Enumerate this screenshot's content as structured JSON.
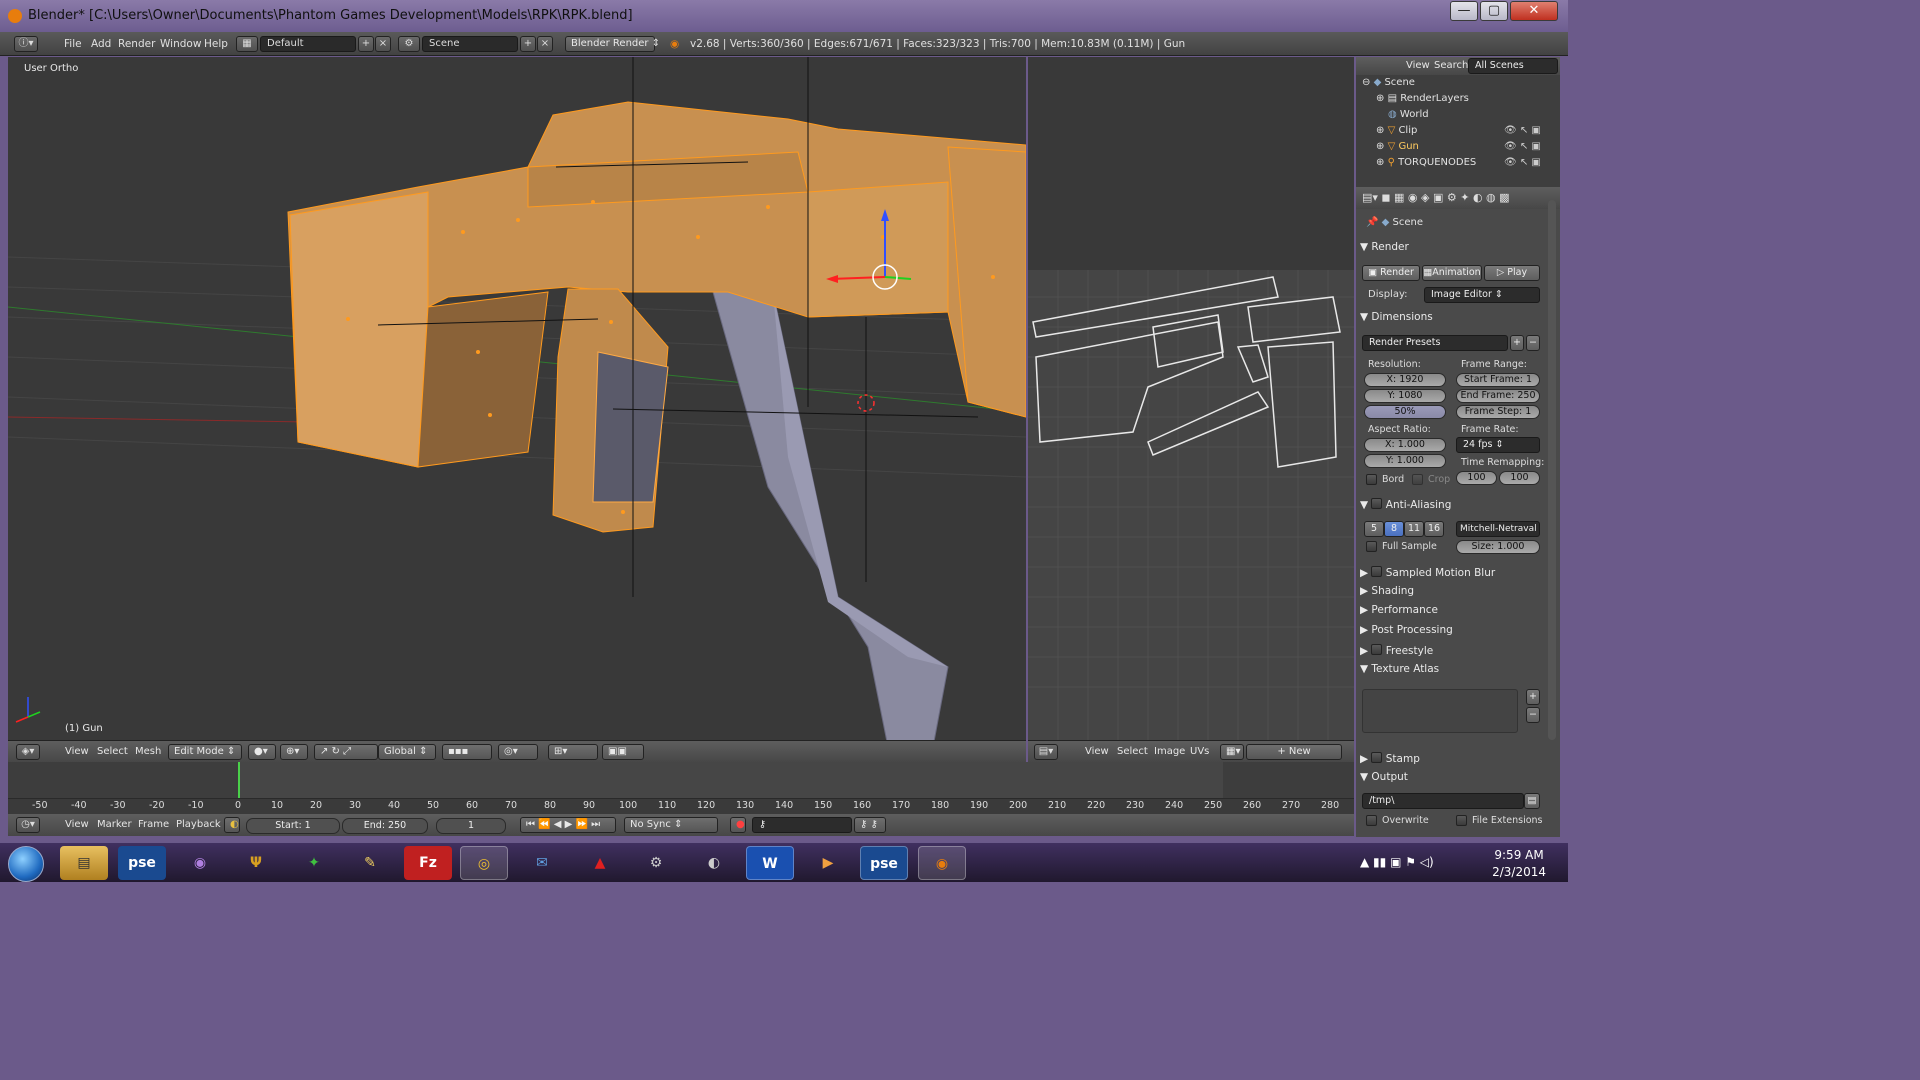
{
  "window": {
    "title": "Blender* [C:\\Users\\Owner\\Documents\\Phantom Games Development\\Models\\RPK\\RPK.blend]",
    "buttons": [
      "—",
      "▢",
      "✕"
    ]
  },
  "info_header": {
    "menus": [
      "File",
      "Add",
      "Render",
      "Window",
      "Help"
    ],
    "screen_layout": "Default",
    "scene": "Scene",
    "engine": "Blender Render",
    "stats": "v2.68 | Verts:360/360 | Edges:671/671 | Faces:323/323 | Tris:700 | Mem:10.83M (0.11M) | Gun"
  },
  "viewport": {
    "view_label": "User Ortho",
    "object_label": "(1) Gun"
  },
  "view3d_header": {
    "menus": [
      "View",
      "Select",
      "Mesh"
    ],
    "mode": "Edit Mode",
    "orientation": "Global"
  },
  "uv_header": {
    "menus": [
      "View",
      "Select",
      "Image",
      "UVs"
    ],
    "new_label": "New"
  },
  "timeline": {
    "ticks": [
      "-50",
      "-40",
      "-30",
      "-20",
      "-10",
      "0",
      "10",
      "20",
      "30",
      "40",
      "50",
      "60",
      "70",
      "80",
      "90",
      "100",
      "110",
      "120",
      "130",
      "140",
      "150",
      "160",
      "170",
      "180",
      "190",
      "200",
      "210",
      "220",
      "230",
      "240",
      "250",
      "260",
      "270",
      "280"
    ],
    "menus": [
      "View",
      "Marker",
      "Frame",
      "Playback"
    ],
    "start": "Start: 1",
    "end": "End: 250",
    "current": "1",
    "sync": "No Sync"
  },
  "outliner": {
    "menus": [
      "View",
      "Search"
    ],
    "filter": "All Scenes",
    "items": [
      "Scene",
      "RenderLayers",
      "World",
      "Clip",
      "Gun",
      "TORQUENODES"
    ]
  },
  "properties": {
    "context": "Scene",
    "render_panel": "Render",
    "render_btn": "Render",
    "animation_btn": "Animation",
    "play_btn": "Play",
    "display_label": "Display:",
    "display_value": "Image Editor",
    "dimensions_panel": "Dimensions",
    "presets": "Render Presets",
    "resolution_label": "Resolution:",
    "res_x": "X: 1920",
    "res_y": "Y: 1080",
    "res_pct": "50%",
    "frame_range_label": "Frame Range:",
    "start_frame": "Start Frame: 1",
    "end_frame": "End Frame: 250",
    "frame_step": "Frame Step: 1",
    "aspect_label": "Aspect Ratio:",
    "aspect_x": "X: 1.000",
    "aspect_y": "Y: 1.000",
    "frame_rate_label": "Frame Rate:",
    "fps": "24 fps",
    "time_remap_label": "Time Remapping:",
    "remap_old": "100",
    "remap_new": "100",
    "bord": "Bord",
    "crop": "Crop",
    "aa_panel": "Anti-Aliasing",
    "aa_samples": [
      "5",
      "8",
      "11",
      "16"
    ],
    "aa_filter": "Mitchell-Netraval",
    "full_sample": "Full Sample",
    "aa_size": "Size: 1.000",
    "collapsed_panels": [
      "Sampled Motion Blur",
      "Shading",
      "Performance",
      "Post Processing",
      "Freestyle"
    ],
    "texture_atlas": "Texture Atlas",
    "stamp": "Stamp",
    "output_panel": "Output",
    "output_path": "/tmp\\",
    "overwrite": "Overwrite",
    "file_extensions": "File Extensions"
  },
  "taskbar": {
    "apps": [
      "Windows Explorer",
      "Photoshop Elements",
      "Unknown App",
      "Tool",
      "Crystal App",
      "Paint Tool",
      "FileZilla",
      "Google Chrome",
      "Thunderbird",
      "Autodesk",
      "Steam",
      "Eclipse",
      "Microsoft Word",
      "Media Player",
      "Photoshop Elements 2",
      "Blender"
    ],
    "time": "9:59 AM",
    "date": "2/3/2014"
  }
}
